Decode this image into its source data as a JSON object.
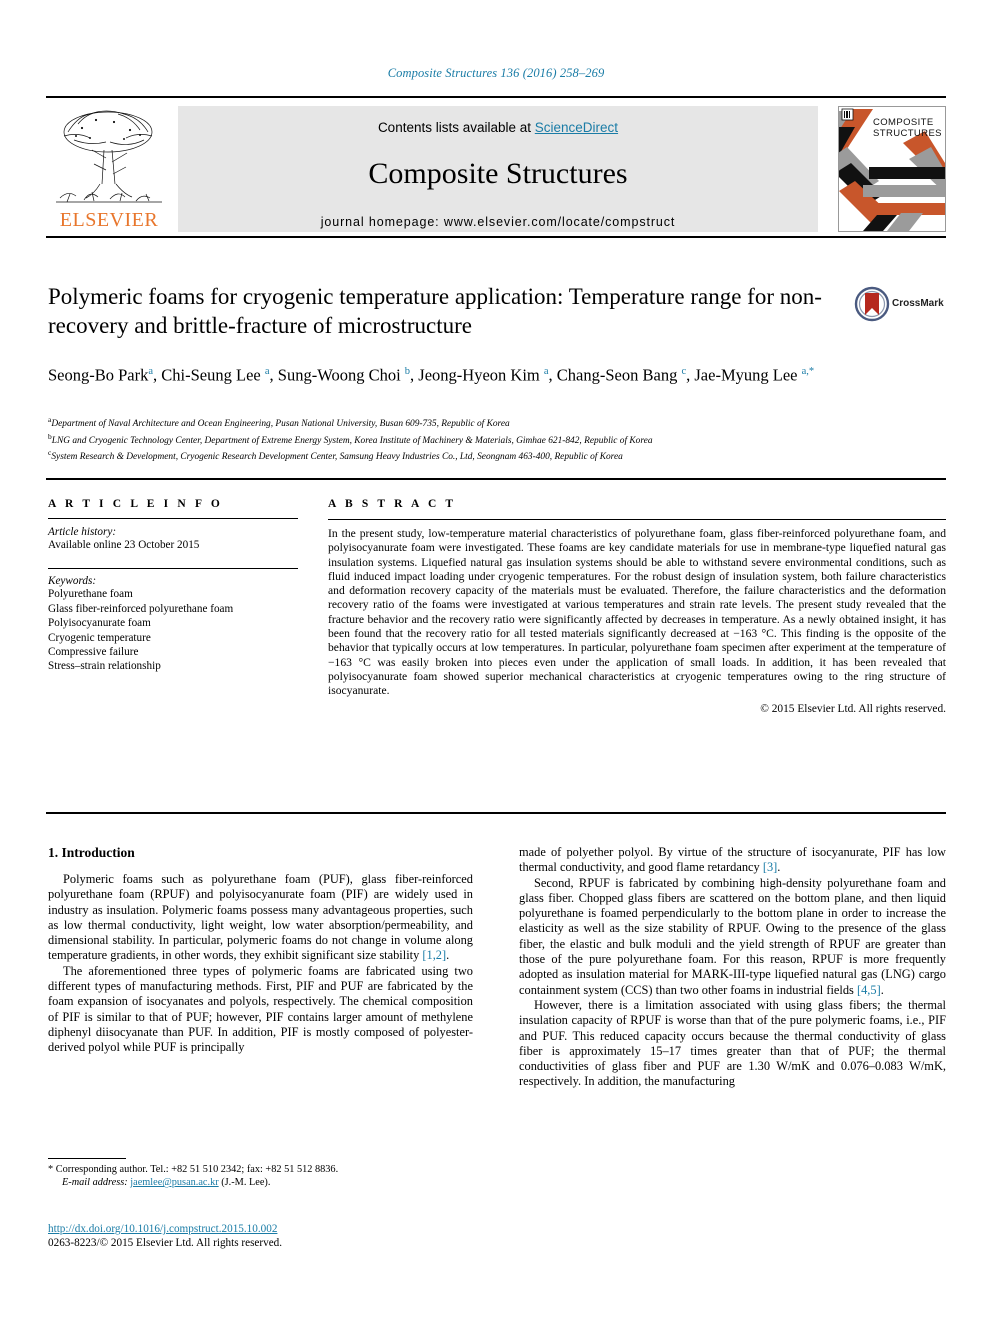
{
  "running_head": "Composite Structures 136 (2016) 258–269",
  "masthead": {
    "contents_prefix": "Contents lists available at ",
    "sciencedirect": "ScienceDirect",
    "journal_name": "Composite Structures",
    "homepage": "journal homepage: www.elsevier.com/locate/compstruct",
    "publisher_wordmark": "ELSEVIER",
    "cover_title_line1": "COMPOSITE",
    "cover_title_line2": "STRUCTURES",
    "accent_orange": "#c8562b",
    "accent_gray": "#9b9b9b",
    "link_blue": "#1a7ca6"
  },
  "article": {
    "title": "Polymeric foams for cryogenic temperature application: Temperature range for non-recovery and brittle-fracture of microstructure",
    "crossmark_label": "CrossMark",
    "authors_html": "Seong-Bo Park<sup>a</sup>, Chi-Seung Lee <sup>a</sup>, Sung-Woong Choi <sup>b</sup>, Jeong-Hyeon Kim <sup>a</sup>, Chang-Seon Bang <sup>c</sup>, Jae-Myung Lee <sup>a,*</sup>",
    "affiliations": [
      {
        "marker": "a",
        "text": "Department of Naval Architecture and Ocean Engineering, Pusan National University, Busan 609-735, Republic of Korea"
      },
      {
        "marker": "b",
        "text": "LNG and Cryogenic Technology Center, Department of Extreme Energy System, Korea Institute of Machinery & Materials, Gimhae 621-842, Republic of Korea"
      },
      {
        "marker": "c",
        "text": "System Research & Development, Cryogenic Research Development Center, Samsung Heavy Industries Co., Ltd, Seongnam 463-400, Republic of Korea"
      }
    ]
  },
  "article_info": {
    "heading": "A R T I C L E   I N F O",
    "history_label": "Article history:",
    "history_value": "Available online 23 October 2015",
    "keywords_label": "Keywords:",
    "keywords": [
      "Polyurethane foam",
      "Glass fiber-reinforced polyurethane foam",
      "Polyisocyanurate foam",
      "Cryogenic temperature",
      "Compressive failure",
      "Stress–strain relationship"
    ]
  },
  "abstract": {
    "heading": "A B S T R A C T",
    "text": "In the present study, low-temperature material characteristics of polyurethane foam, glass fiber-reinforced polyurethane foam, and polyisocyanurate foam were investigated. These foams are key candidate materials for use in membrane-type liquefied natural gas insulation systems. Liquefied natural gas insulation systems should be able to withstand severe environmental conditions, such as fluid induced impact loading under cryogenic temperatures. For the robust design of insulation system, both failure characteristics and deformation recovery capacity of the materials must be evaluated. Therefore, the failure characteristics and the deformation recovery ratio of the foams were investigated at various temperatures and strain rate levels. The present study revealed that the fracture behavior and the recovery ratio were significantly affected by decreases in temperature. As a newly obtained insight, it has been found that the recovery ratio for all tested materials significantly decreased at −163 °C. This finding is the opposite of the behavior that typically occurs at low temperatures. In particular, polyurethane foam specimen after experiment at the temperature of −163 °C was easily broken into pieces even under the application of small loads. In addition, it has been revealed that polyisocyanurate foam showed superior mechanical characteristics at cryogenic temperatures owing to the ring structure of isocyanurate.",
    "copyright": "© 2015 Elsevier Ltd. All rights reserved."
  },
  "introduction": {
    "heading": "1. Introduction",
    "left_paragraphs": [
      "Polymeric foams such as polyurethane foam (PUF), glass fiber-reinforced polyurethane foam (RPUF) and polyisocyanurate foam (PIF) are widely used in industry as insulation. Polymeric foams possess many advantageous properties, such as low thermal conductivity, light weight, low water absorption/permeability, and dimensional stability. In particular, polymeric foams do not change in volume along temperature gradients, in other words, they exhibit significant size stability ",
      "The aforementioned three types of polymeric foams are fabricated using two different types of manufacturing methods. First, PIF and PUF are fabricated by the foam expansion of isocyanates and polyols, respectively. The chemical composition of PIF is similar to that of PUF; however, PIF contains larger amount of methylene diphenyl diisocyanate than PUF. In addition, PIF is mostly composed of polyester-derived polyol while PUF is principally"
    ],
    "left_ref_1": "[1,2]",
    "right_paragraphs": [
      "made of polyether polyol. By virtue of the structure of isocyanurate, PIF has low thermal conductivity, and good flame retardancy ",
      "Second, RPUF is fabricated by combining high-density polyurethane foam and glass fiber. Chopped glass fibers are scattered on the bottom plane, and then liquid polyurethane is foamed perpendicularly to the bottom plane in order to increase the elasticity as well as the size stability of RPUF. Owing to the presence of the glass fiber, the elastic and bulk moduli and the yield strength of RPUF are greater than those of the pure polyurethane foam. For this reason, RPUF is more frequently adopted as insulation material for MARK-III-type liquefied natural gas (LNG) cargo containment system (CCS) than two other foams in industrial fields ",
      "However, there is a limitation associated with using glass fibers; the thermal insulation capacity of RPUF is worse than that of the pure polymeric foams, i.e., PIF and PUF. This reduced capacity occurs because the thermal conductivity of glass fiber is approximately 15–17 times greater than that of PUF; the thermal conductivities of glass fiber and PUF are 1.30 W/mK and 0.076–0.083 W/mK, respectively. In addition, the manufacturing"
    ],
    "right_ref_3": "[3]",
    "right_ref_45": "[4,5]"
  },
  "footnote": {
    "marker": "*",
    "line1": "Corresponding author. Tel.: +82 51 510 2342; fax: +82 51 512 8836.",
    "email_label": "E-mail address:",
    "email": "jaemlee@pusan.ac.kr",
    "email_suffix": "(J.-M. Lee)."
  },
  "doi_block": {
    "doi": "http://dx.doi.org/10.1016/j.compstruct.2015.10.002",
    "issn_line": "0263-8223/© 2015 Elsevier Ltd. All rights reserved."
  }
}
